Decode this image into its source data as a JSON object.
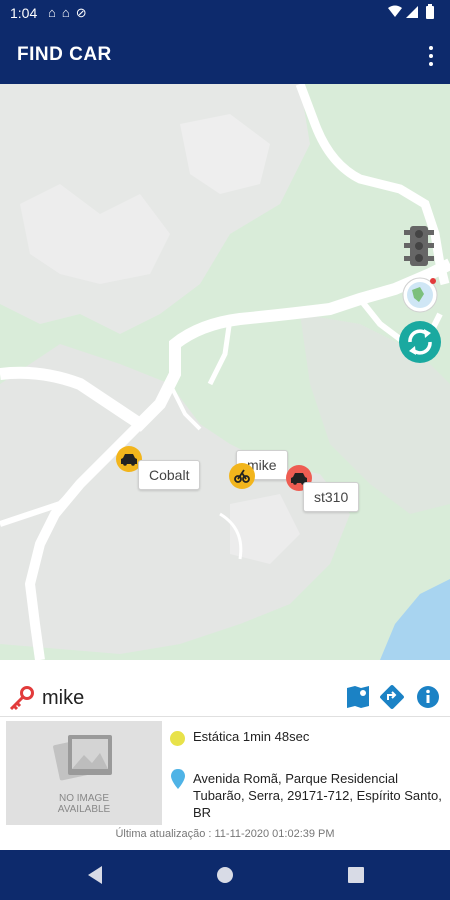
{
  "status_bar": {
    "time": "1:04"
  },
  "app_bar": {
    "title": "FIND CAR"
  },
  "map": {
    "markers": [
      {
        "label": "Cobalt",
        "color": "#f2b51c"
      },
      {
        "label": "mike",
        "color": "#f2b51c"
      },
      {
        "label": "st310",
        "color": "#ee5d52"
      }
    ]
  },
  "vehicle": {
    "name": "mike",
    "image_placeholder": "NO IMAGE\nAVAILABLE",
    "status": "Estática 1min 48sec",
    "status_color": "#e8e24a",
    "address": "Avenida Romã, Parque Residencial Tubarão, Serra, 29171-712, Espírito Santo, BR",
    "last_update": "Última atualização : 11-11-2020 01:02:39 PM"
  },
  "colors": {
    "primary": "#0d2a6c",
    "accent": "#1b82c5",
    "key": "#e23b3b"
  }
}
